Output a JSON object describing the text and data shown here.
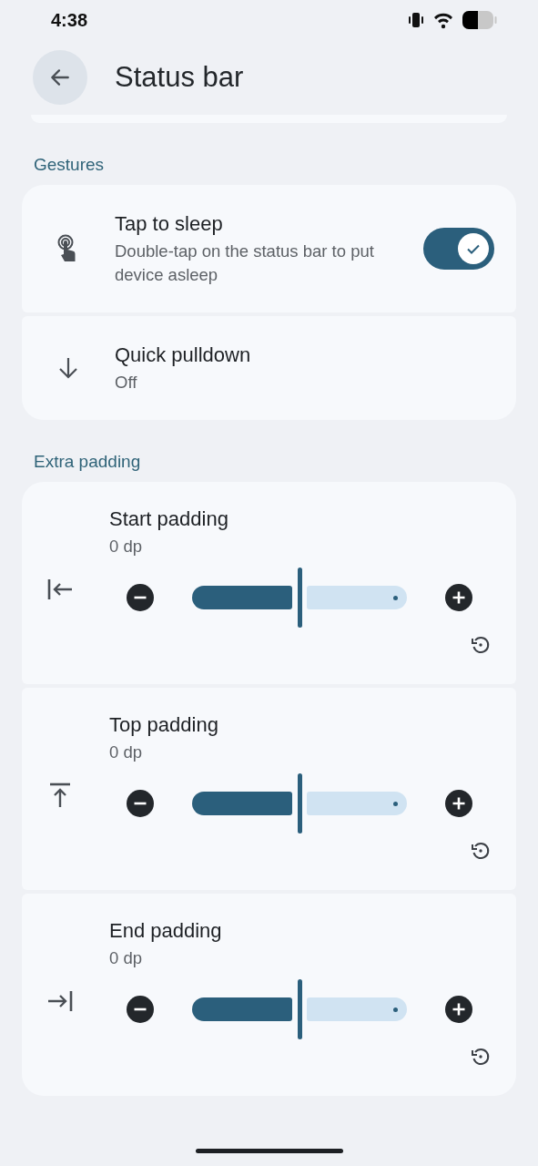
{
  "status_bar": {
    "time": "4:38"
  },
  "header": {
    "title": "Status bar"
  },
  "sections": [
    {
      "title": "Gestures",
      "items": [
        {
          "kind": "switch",
          "title": "Tap to sleep",
          "summary": "Double-tap on the status bar to put device asleep",
          "on": true
        },
        {
          "kind": "value",
          "title": "Quick pulldown",
          "summary": "Off"
        }
      ]
    },
    {
      "title": "Extra padding",
      "items": [
        {
          "kind": "slider",
          "title": "Start padding",
          "summary": "0 dp",
          "level": 0.5
        },
        {
          "kind": "slider",
          "title": "Top padding",
          "summary": "0 dp",
          "level": 0.5
        },
        {
          "kind": "slider",
          "title": "End padding",
          "summary": "0 dp",
          "level": 0.5
        }
      ]
    }
  ]
}
